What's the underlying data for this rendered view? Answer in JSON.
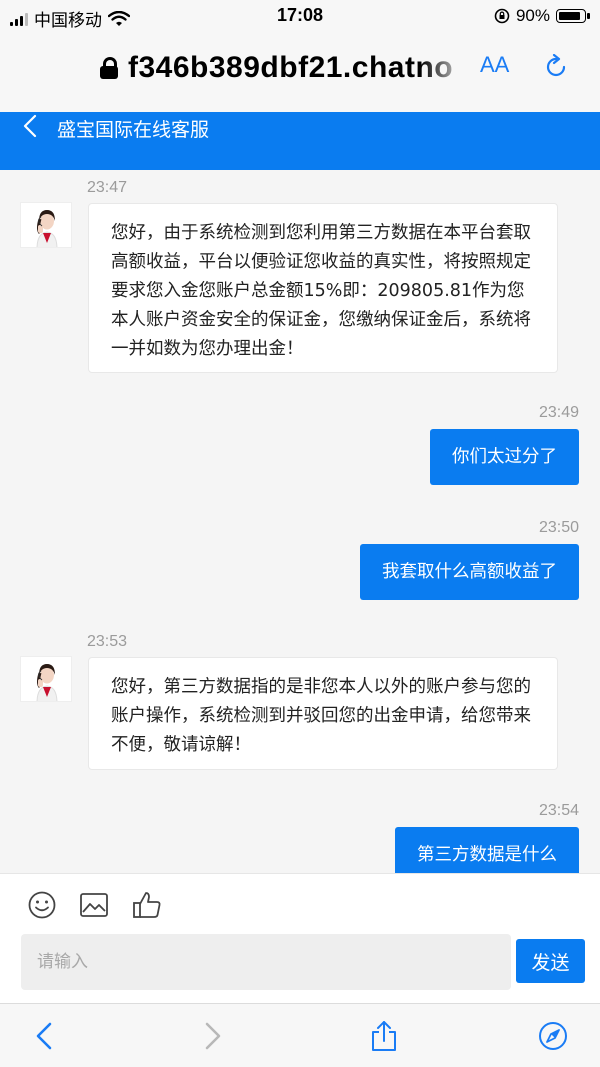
{
  "status_bar": {
    "carrier": "中国移动",
    "time": "17:08",
    "battery": "90%",
    "battery_level": 0.9
  },
  "browser": {
    "url": "f346b389dbf21.chatno",
    "text_size_label": "AA"
  },
  "chat": {
    "title": "盛宝国际在线客服"
  },
  "messages": [
    {
      "side": "left",
      "time": "23:47",
      "text": "您好，由于系统检测到您利用第三方数据在本平台套取高额收益，平台以便验证您收益的真实性，将按照规定要求您入金您账户总金额15%即：209805.81作为您本人账户资金安全的保证金，您缴纳保证金后，系统将一并如数为您办理出金！"
    },
    {
      "side": "right",
      "time": "23:49",
      "text": "你们太过分了"
    },
    {
      "side": "right",
      "time": "23:50",
      "text": "我套取什么高额收益了"
    },
    {
      "side": "left",
      "time": "23:53",
      "text": "您好，第三方数据指的是非您本人以外的账户参与您的账户操作，系统检测到并驳回您的出金申请，给您带来不便，敬请谅解！"
    },
    {
      "side": "right",
      "time": "23:54",
      "text": "第三方数据是什么"
    }
  ],
  "composer": {
    "placeholder": "请输入",
    "send_label": "发送",
    "tools": [
      "emoji-icon",
      "image-icon",
      "thumbs-up-icon"
    ]
  },
  "toolbar": {
    "icons": [
      "back-icon",
      "forward-icon",
      "share-icon",
      "compass-icon"
    ]
  },
  "colors": {
    "accent": "#0a7cf0",
    "safari_blue": "#1a7cf5",
    "background": "#f5f5f5"
  }
}
